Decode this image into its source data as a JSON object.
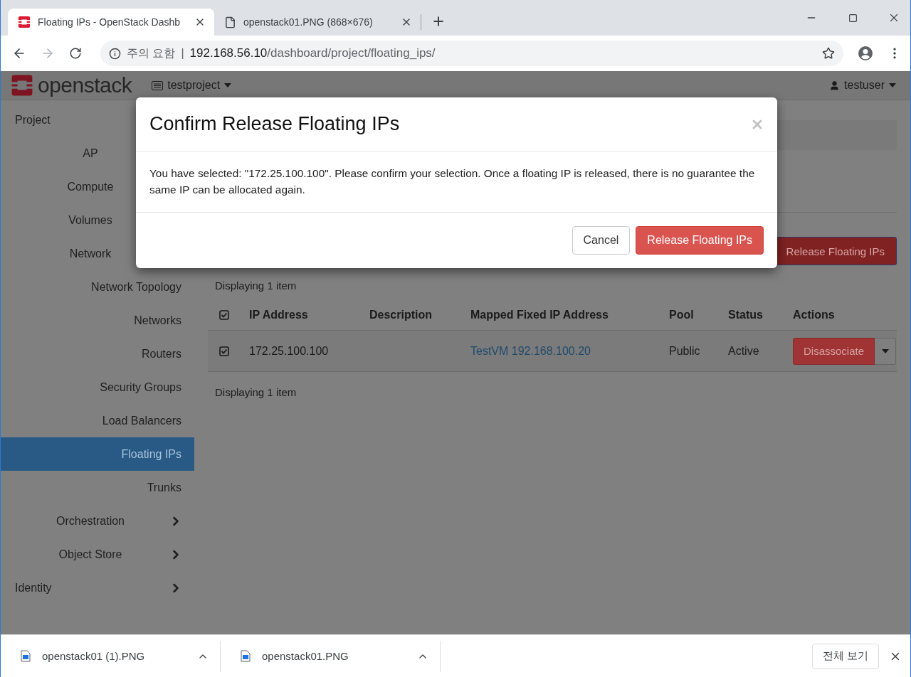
{
  "browser": {
    "tabs": [
      {
        "title": "Floating IPs - OpenStack Dashb",
        "selected": true
      },
      {
        "title": "openstack01.PNG (868×676)",
        "selected": false
      }
    ],
    "address": {
      "security": "주의 요함",
      "separator": "|",
      "host": "192.168.56.10",
      "path": "/dashboard/project/floating_ips/"
    }
  },
  "header": {
    "brand": "openstack",
    "project": "testproject",
    "user": "testuser"
  },
  "sidebar": {
    "items": [
      {
        "label": "Project",
        "selected": false,
        "children": [
          {
            "label": "AP",
            "selected": false
          },
          {
            "label": "Compute",
            "selected": false
          },
          {
            "label": "Volumes",
            "selected": false
          },
          {
            "label": "Network",
            "selected": false,
            "children": [
              {
                "label": "Network Topology",
                "selected": false
              },
              {
                "label": "Networks",
                "selected": false
              },
              {
                "label": "Routers",
                "selected": false
              },
              {
                "label": "Security Groups",
                "selected": false
              },
              {
                "label": "Load Balancers",
                "selected": false
              },
              {
                "label": "Floating IPs",
                "selected": true
              },
              {
                "label": "Trunks",
                "selected": false
              }
            ]
          },
          {
            "label": "Orchestration",
            "selected": false,
            "expanded": false
          },
          {
            "label": "Object Store",
            "selected": false,
            "expanded": false
          }
        ]
      },
      {
        "label": "Identity",
        "selected": false,
        "expanded": false
      }
    ]
  },
  "page": {
    "action_button": "Release Floating IPs",
    "count_top": "Displaying 1 item",
    "count_bottom": "Displaying 1 item",
    "table": {
      "all_checked": true,
      "columns": [
        "IP Address",
        "Description",
        "Mapped Fixed IP Address",
        "Pool",
        "Status",
        "Actions"
      ],
      "rows": [
        {
          "checked": true,
          "ip_address": "172.25.100.100",
          "mapped_fixed_ip": "TestVM 192.168.100.20",
          "pool": "Public",
          "status": "Active",
          "action": "Disassociate"
        }
      ]
    }
  },
  "modal": {
    "title": "Confirm Release Floating IPs",
    "message": "You have selected: \"172.25.100.100\". Please confirm your selection. Once a floating IP is released, there is no guarantee the same IP can be allocated again.",
    "buttons": [
      {
        "label": "Cancel",
        "kind": "default"
      },
      {
        "label": "Release Floating IPs",
        "kind": "danger"
      }
    ]
  },
  "downloads": {
    "items": [
      "openstack01 (1).PNG",
      "openstack01.PNG"
    ],
    "show_all": "전체 보기"
  }
}
